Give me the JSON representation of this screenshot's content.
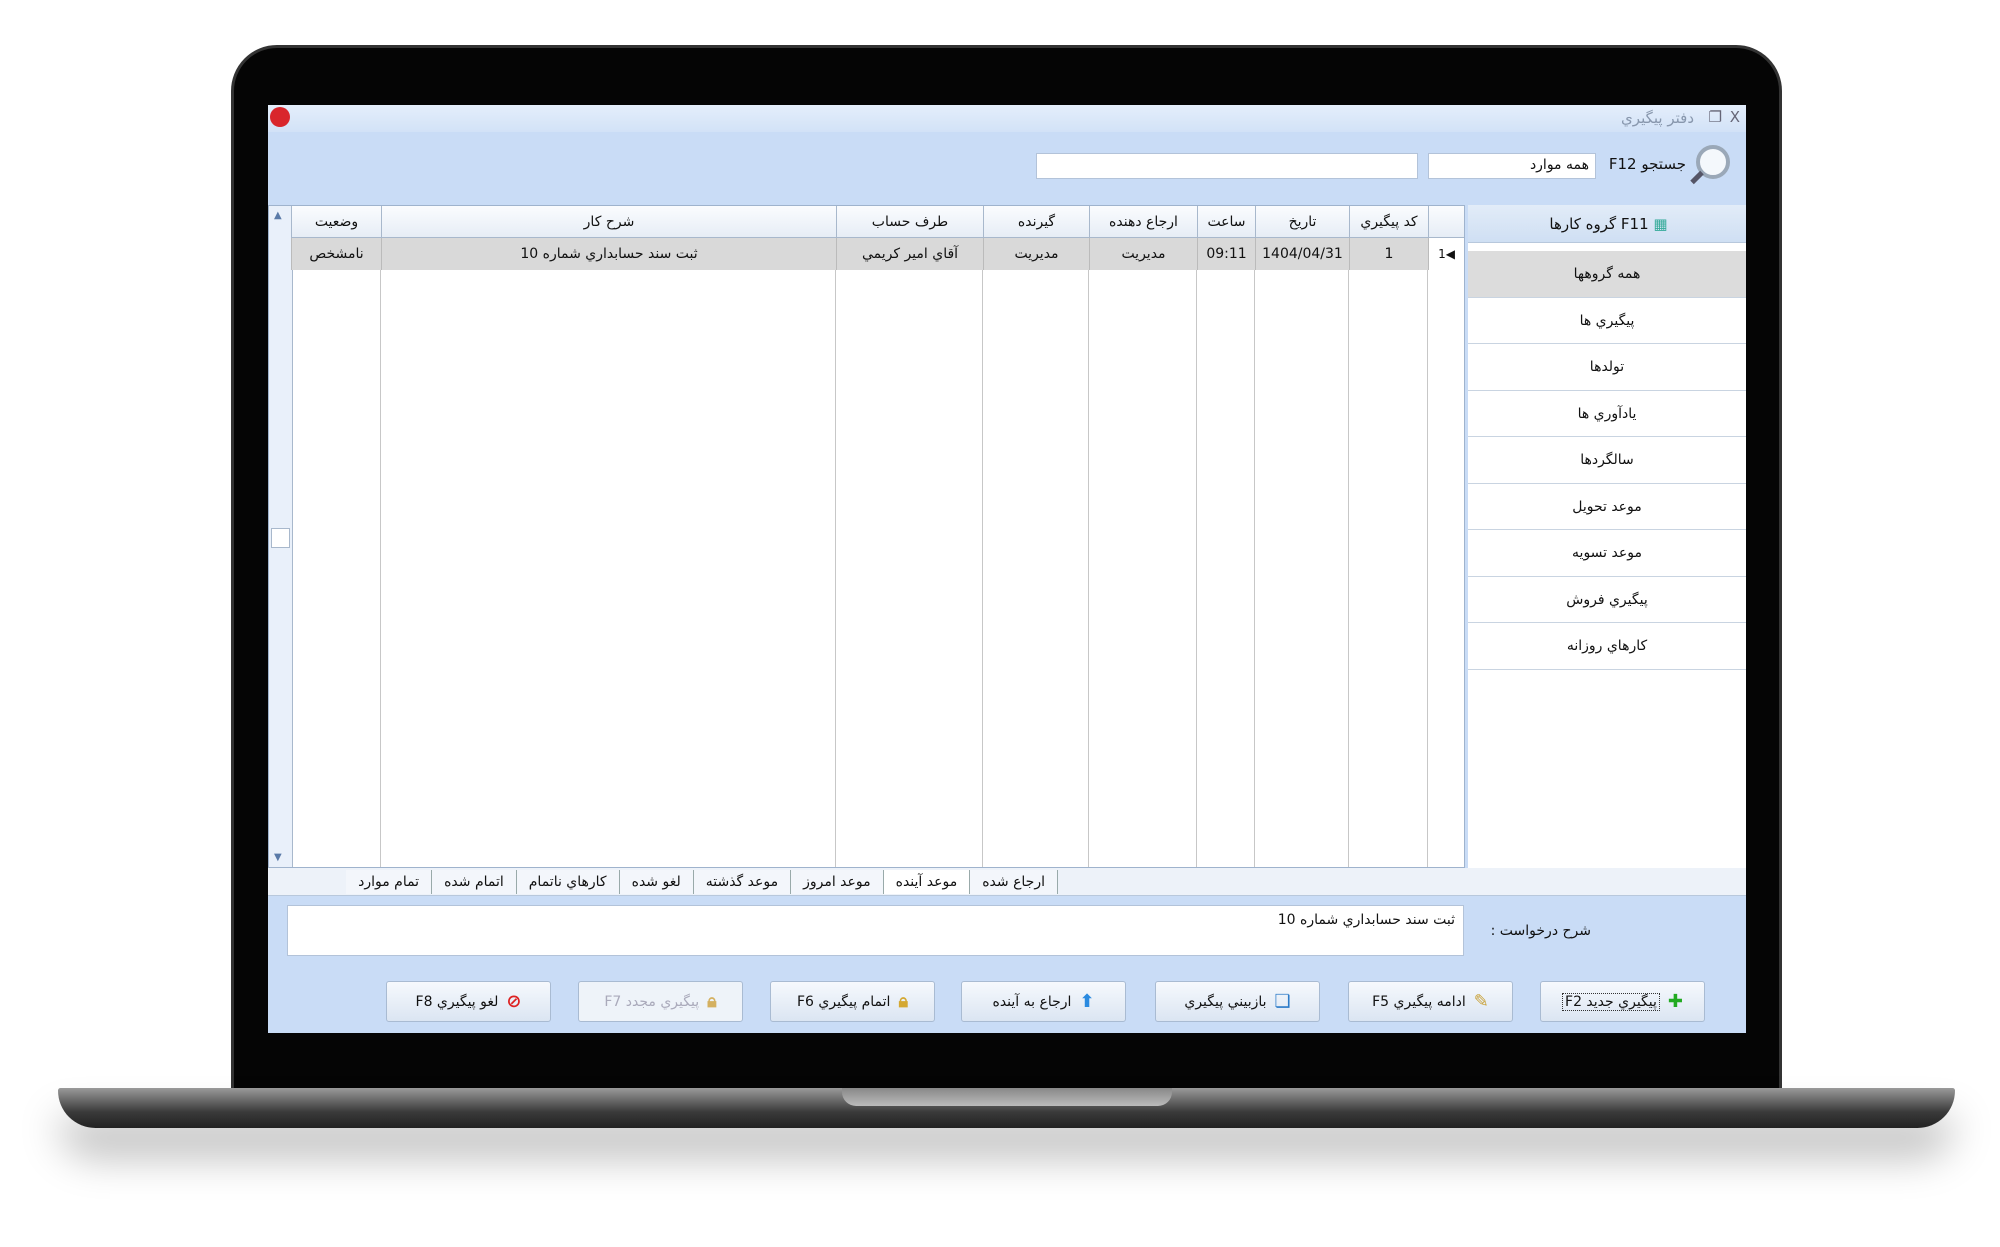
{
  "window": {
    "title": "دفتر پيگيري",
    "minimize": "–",
    "maximize": "❐",
    "close": "X"
  },
  "search": {
    "label": "جستجو F12",
    "filter_value": "همه موارد",
    "query_value": ""
  },
  "grid": {
    "columns": [
      "كد پيگيري",
      "تاريخ",
      "ساعت",
      "ارجاع دهنده",
      "گيرنده",
      "طرف حساب",
      "شرح كار",
      "وضعيت"
    ],
    "rows": [
      {
        "indicator": "◀1",
        "code": "1",
        "date": "1404/04/31",
        "time": "09:11",
        "referrer": "مديريت",
        "receiver": "مديريت",
        "account": "آقاي امير كريمي",
        "description": "ثبت سند حسابداري شماره 10",
        "status": "نامشخص"
      }
    ]
  },
  "sidebar": {
    "header": "F11 گروه كارها",
    "items": [
      "همه گروهها",
      "پيگيري ها",
      "تولدها",
      "يادآوري ها",
      "سالگردها",
      "موعد تحويل",
      "موعد تسويه",
      "پيگيري فروش",
      "كارهاي روزانه"
    ]
  },
  "tabs": [
    "ارجاع شده",
    "موعد آينده",
    "موعد امروز",
    "موعد گذشته",
    "لغو شده",
    "كارهاي ناتمام",
    "اتمام شده",
    "تمام موارد"
  ],
  "details": {
    "label": "شرح درخواست :",
    "value": "ثبت سند حسابداري شماره 10"
  },
  "buttons": [
    "پيگيري جديد F2",
    "ادامه پيگيري F5",
    "بازبيني پيگيري",
    "ارجاع به آينده",
    "اتمام پيگيري F6",
    "پيگيري مجدد F7",
    "لغو پيگيري F8"
  ]
}
